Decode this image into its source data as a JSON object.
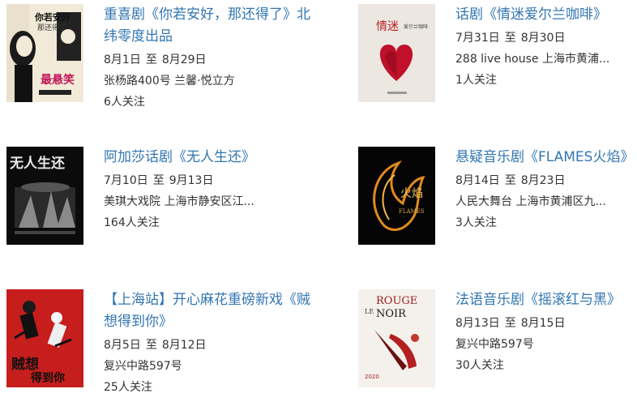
{
  "events": [
    {
      "title": "重喜剧《你若安好，那还得了》北纬零度出品",
      "date_start": "8月1日",
      "date_sep": "至",
      "date_end": "8月29日",
      "venue": "张杨路400号 兰馨·悦立方",
      "followers": "6人关注",
      "poster_text": [
        "你若安好",
        "那还得了",
        "最悬笑"
      ]
    },
    {
      "title": "话剧《情迷爱尔兰咖啡》",
      "date_start": "7月31日",
      "date_sep": "至",
      "date_end": "8月30日",
      "venue": "288 live house 上海市黄浦...",
      "followers": "1人关注",
      "poster_text": [
        "情迷",
        "爱尔兰咖啡"
      ]
    },
    {
      "title": "阿加莎话剧《无人生还》",
      "date_start": "7月10日",
      "date_sep": "至",
      "date_end": "9月13日",
      "venue": "美琪大戏院 上海市静安区江...",
      "followers": "164人关注",
      "poster_text": [
        "无人生还"
      ]
    },
    {
      "title": "悬疑音乐剧《FLAMES火焰》",
      "date_start": "8月14日",
      "date_sep": "至",
      "date_end": "8月23日",
      "venue": "人民大舞台 上海市黄浦区九...",
      "followers": "3人关注",
      "poster_text": [
        "火焰",
        "FLAMES"
      ]
    },
    {
      "title": "【上海站】开心麻花重磅新戏《贼想得到你》",
      "date_start": "8月5日",
      "date_sep": "至",
      "date_end": "8月12日",
      "venue": "复兴中路597号",
      "followers": "25人关注",
      "poster_text": [
        "贼想",
        "得到你"
      ]
    },
    {
      "title": "法语音乐剧《摇滚红与黑》",
      "date_start": "8月13日",
      "date_sep": "至",
      "date_end": "8月15日",
      "venue": "复兴中路597号",
      "followers": "30人关注",
      "poster_text": [
        "ROUGE",
        "LE",
        "NOIR",
        "2020"
      ]
    }
  ],
  "colors": {
    "title": "#3276b1",
    "text": "#333333"
  }
}
